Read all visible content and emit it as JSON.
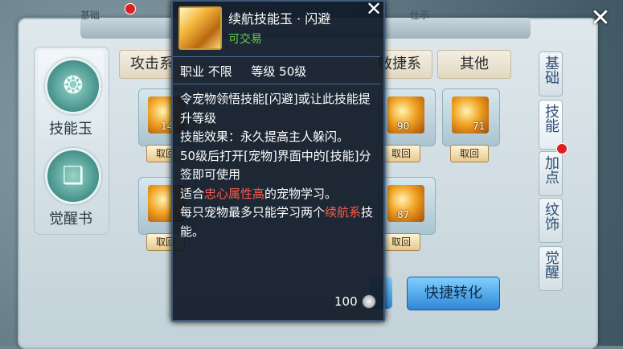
{
  "header": {
    "tab_left": "基础",
    "tab_right": "仕示"
  },
  "left_tabs": [
    {
      "label": "技能玉"
    },
    {
      "label": "觉醒书"
    }
  ],
  "categories": {
    "attack": "攻击系",
    "swift": "敏捷系",
    "other": "其他"
  },
  "slots": {
    "row1": [
      {
        "count": "14",
        "retrieve": "取回"
      },
      {
        "count": "90",
        "retrieve": "取回"
      },
      {
        "count": "71",
        "retrieve": "取回"
      }
    ],
    "row2": [
      {
        "count": "",
        "retrieve": "取回"
      },
      {
        "count": "87",
        "retrieve": "取回"
      }
    ]
  },
  "buttons": {
    "quick_convert": "快捷转化"
  },
  "right_tabs": [
    "基础",
    "技能",
    "加点",
    "纹饰",
    "觉醒"
  ],
  "tooltip": {
    "name": "续航技能玉 · 闪避",
    "tradable": "可交易",
    "job_label": "职业",
    "job_value": "不限",
    "level_label": "等级",
    "level_value": "50级",
    "desc_1": "令宠物领悟技能[闪避]或让此技能提升等级",
    "desc_2": "技能效果：永久提高主人躲闪。",
    "desc_3": "50级后打开[宠物]界面中的[技能]分签即可使用",
    "desc_4a": "适合",
    "desc_4b": "忠心属性高",
    "desc_4c": "的宠物学习。",
    "desc_5a": "每只宠物最多只能学习两个",
    "desc_5b": "续航系",
    "desc_5c": "技能。",
    "cost": "100"
  },
  "colors": {
    "highlight": "#ff5a4a",
    "tradable": "#5fd04c"
  }
}
